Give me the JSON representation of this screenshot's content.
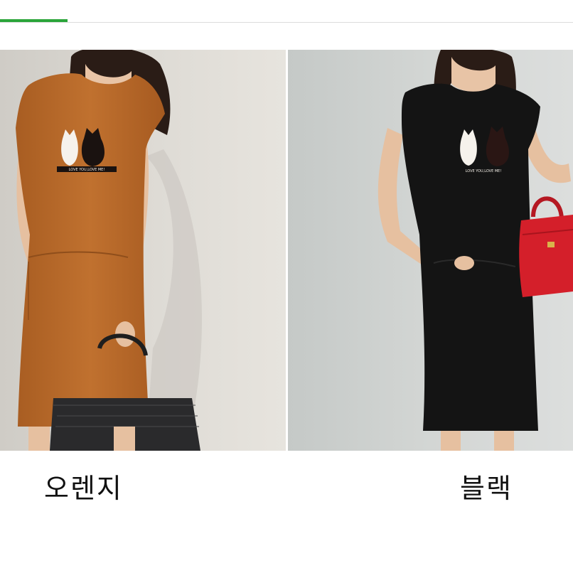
{
  "products": [
    {
      "color_name": "오렌지",
      "dress_color": "#b8692a",
      "print_text": "LOVE YOU,LOVE ME!"
    },
    {
      "color_name": "블랙",
      "dress_color": "#141414",
      "print_text": "LOVE YOU,LOVE ME!"
    }
  ],
  "colors": {
    "accent": "#2aa53a",
    "bag_red": "#d41f2a"
  }
}
